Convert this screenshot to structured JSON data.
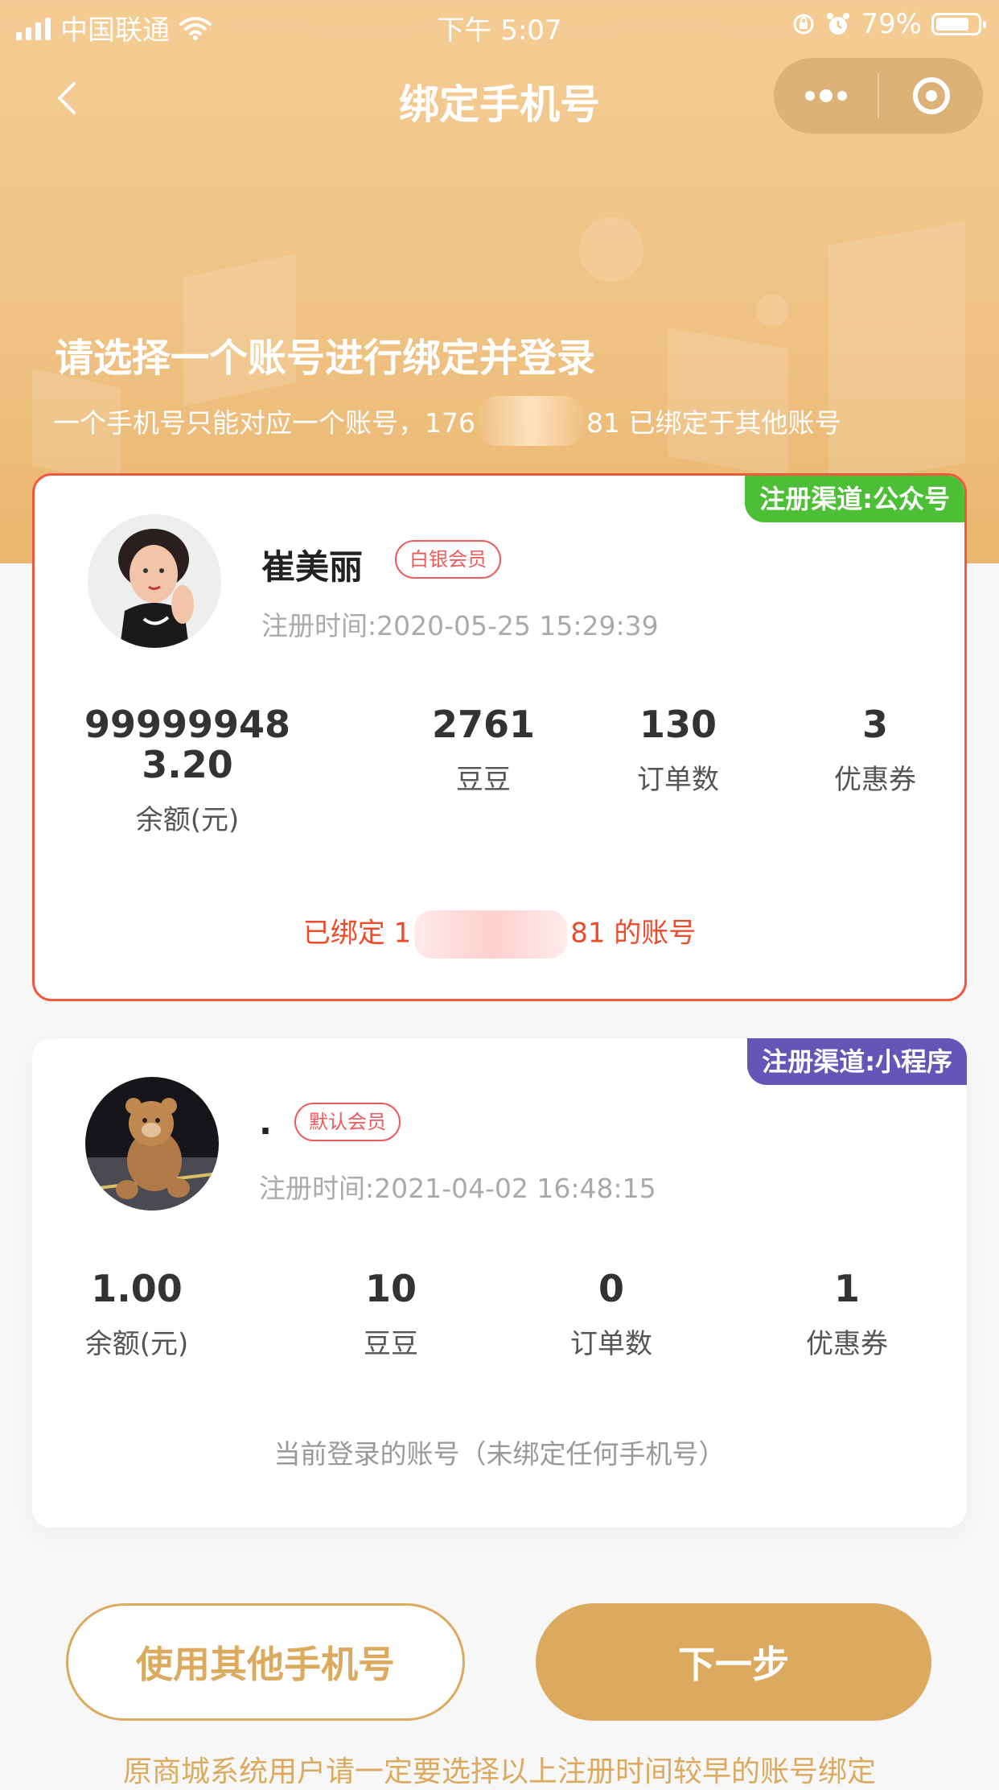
{
  "status_bar": {
    "carrier": "中国联通",
    "time": "下午 5:07",
    "battery": "79%",
    "battery_level": 0.79
  },
  "nav": {
    "title": "绑定手机号"
  },
  "hero": {
    "title": "请选择一个账号进行绑定并登录",
    "subtitle_prefix": "一个手机号只能对应一个账号，176",
    "subtitle_suffix": "81 已绑定于其他账号"
  },
  "accounts": [
    {
      "channel": "注册渠道:公众号",
      "channel_color": "#4dbf36",
      "name": "崔美丽",
      "level": "白银会员",
      "reg_time": "注册时间:2020-05-25 15:29:39",
      "stats": {
        "balance": "999999483.20",
        "balance_label": "余额(元)",
        "beans": "2761",
        "beans_label": "豆豆",
        "orders": "130",
        "orders_label": "订单数",
        "coupons": "3",
        "coupons_label": "优惠券"
      },
      "note_prefix": "已绑定 1",
      "note_suffix": "81 的账号",
      "selected": true
    },
    {
      "channel": "注册渠道:小程序",
      "channel_color": "#6655b7",
      "name": ".",
      "level": "默认会员",
      "reg_time": "注册时间:2021-04-02 16:48:15",
      "stats": {
        "balance": "1.00",
        "balance_label": "余额(元)",
        "beans": "10",
        "beans_label": "豆豆",
        "orders": "0",
        "orders_label": "订单数",
        "coupons": "1",
        "coupons_label": "优惠券"
      },
      "note": "当前登录的账号（未绑定任何手机号）",
      "selected": false
    }
  ],
  "buttons": {
    "other_phone": "使用其他手机号",
    "next": "下一步"
  },
  "footer_note": "原商城系统用户请一定要选择以上注册时间较早的账号绑定"
}
